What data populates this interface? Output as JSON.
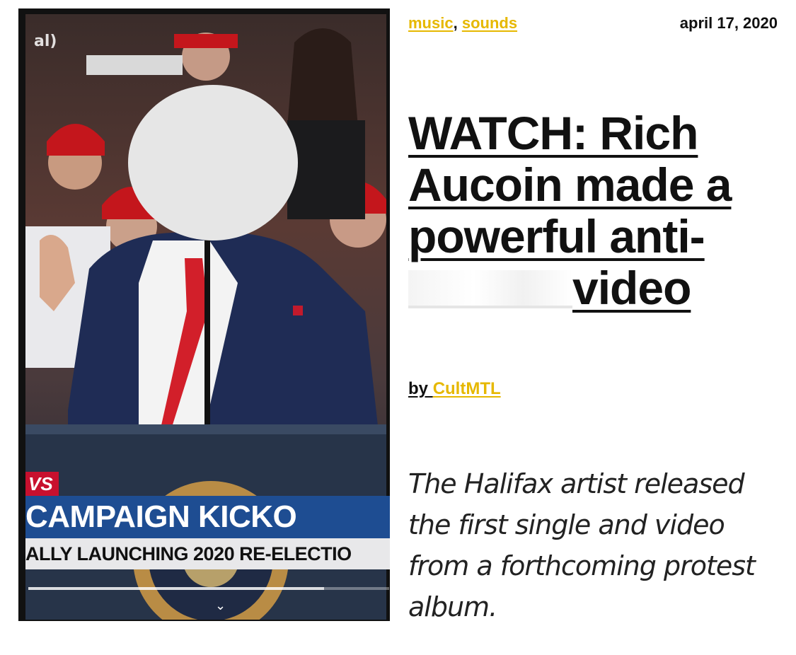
{
  "video": {
    "channel_tag": "al)",
    "lower_third": {
      "tag": "VS",
      "headline": "CAMPAIGN KICKO",
      "subline": "ALLY LAUNCHING 2020 RE-ELECTIO"
    },
    "progress": 0.82
  },
  "article": {
    "categories": [
      "music",
      "sounds"
    ],
    "separator": ", ",
    "date": "april 17, 2020",
    "headline_lines": [
      "WATCH: Rich",
      "Aucoin made a",
      "powerful anti-"
    ],
    "headline_last_word": "video",
    "byline_prefix": "by ",
    "author": "CultMTL",
    "dek": "The Halifax artist released the first single and video from a forthcoming protest album."
  }
}
